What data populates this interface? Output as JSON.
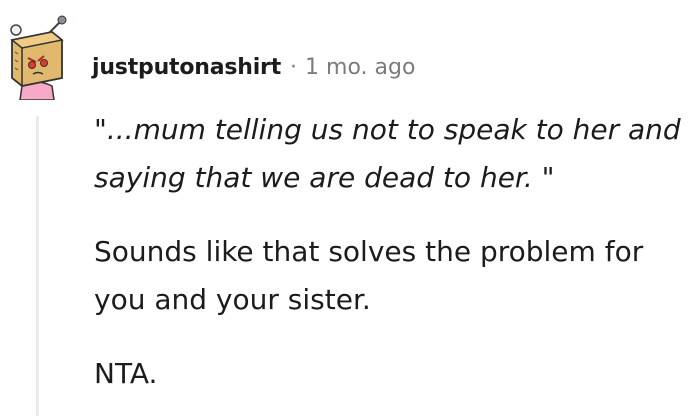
{
  "comment": {
    "author": "justputonashirt",
    "separator": "·",
    "timestamp": "1 mo. ago",
    "avatar_icon": "reddit-snoovatar-box-head-icon",
    "paragraphs": [
      "\"...mum telling us not to speak to her and saying that we are dead to her. \"",
      "Sounds like that solves the problem for you and your sister.",
      "NTA."
    ]
  },
  "colors": {
    "text": "#1c1c1c",
    "meta": "#7c7c7c",
    "thread_line": "#e9ebec"
  }
}
